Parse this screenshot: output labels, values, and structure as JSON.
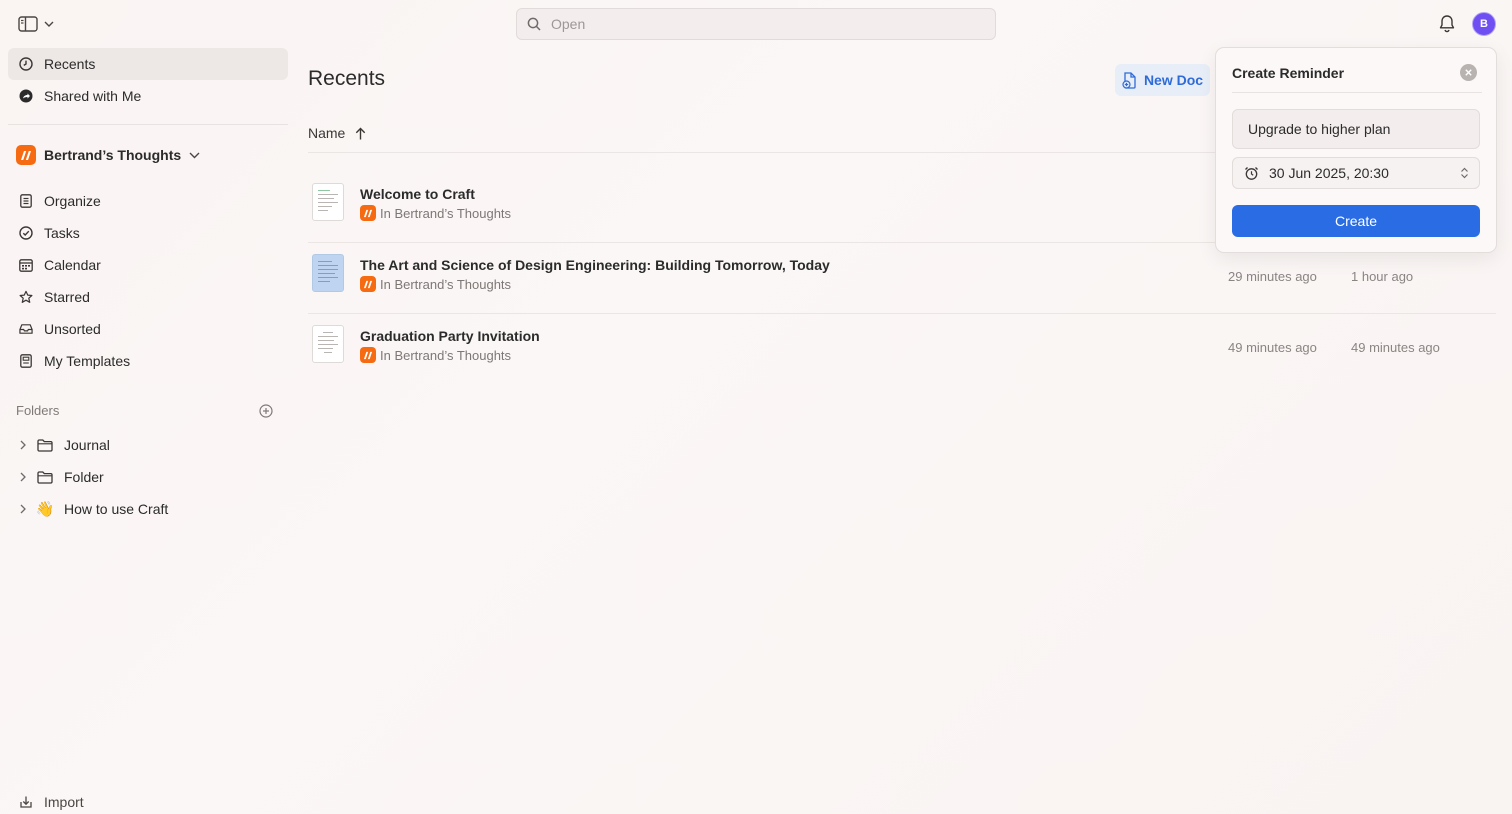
{
  "search": {
    "placeholder": "Open"
  },
  "header": {
    "avatar_initial": "B"
  },
  "sidebar": {
    "nav_top": [
      {
        "label": "Recents",
        "icon": "clock-icon",
        "active": true
      },
      {
        "label": "Shared with Me",
        "icon": "shared-icon"
      }
    ],
    "space_name": "Bertrand’s Thoughts",
    "nav_space": [
      {
        "label": "Organize",
        "icon": "organize-icon"
      },
      {
        "label": "Tasks",
        "icon": "check-circle-icon"
      },
      {
        "label": "Calendar",
        "icon": "calendar-icon"
      },
      {
        "label": "Starred",
        "icon": "star-icon"
      },
      {
        "label": "Unsorted",
        "icon": "inbox-icon"
      },
      {
        "label": "My Templates",
        "icon": "template-icon"
      }
    ],
    "folders_label": "Folders",
    "folders": [
      {
        "label": "Journal",
        "icon": "folder-icon"
      },
      {
        "label": "Folder",
        "icon": "folder-icon"
      },
      {
        "label": "How to use Craft",
        "icon": "waving-hand-icon",
        "emoji": "👋"
      }
    ],
    "import_label": "Import"
  },
  "main": {
    "title": "Recents",
    "new_doc_label": "New Doc",
    "column_name": "Name",
    "docs": [
      {
        "title": "Welcome to Craft",
        "location": "In Bertrand’s Thoughts",
        "modified": "",
        "created": ""
      },
      {
        "title": "The Art and Science of Design Engineering: Building Tomorrow, Today",
        "location": "In Bertrand’s Thoughts",
        "modified": "29 minutes ago",
        "created": "1 hour ago"
      },
      {
        "title": "Graduation Party Invitation",
        "location": "In Bertrand’s Thoughts",
        "modified": "49 minutes ago",
        "created": "49 minutes ago"
      }
    ]
  },
  "reminder": {
    "title": "Create Reminder",
    "text_value": "Upgrade to higher plan",
    "date_value": "30 Jun 2025, 20:30",
    "create_label": "Create"
  },
  "colors": {
    "accent": "#2a6ce3",
    "brand": "#f66b12",
    "avatar": "#6f4ff2"
  }
}
